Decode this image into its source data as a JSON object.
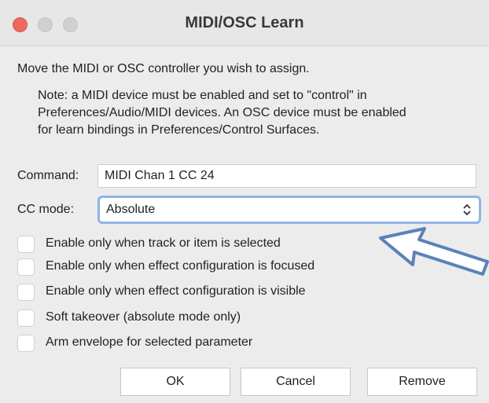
{
  "window": {
    "title": "MIDI/OSC Learn",
    "controls": [
      {
        "name": "close",
        "color": "#ee6a5f"
      },
      {
        "name": "minimize",
        "color": "#d0d0d0"
      },
      {
        "name": "zoom",
        "color": "#d0d0d0"
      }
    ]
  },
  "instructions": "Move the MIDI or OSC controller you wish to assign.",
  "note": {
    "lines": [
      "Note: a MIDI device must be enabled and set to \"control\" in",
      "Preferences/Audio/MIDI devices. An OSC device must be enabled",
      "for learn bindings in Preferences/Control Surfaces."
    ]
  },
  "command": {
    "label": "Command:",
    "value": "MIDI Chan 1 CC 24"
  },
  "cc_mode": {
    "label": "CC mode:",
    "value": "Absolute"
  },
  "options": [
    {
      "label": "Enable only when track or item is selected",
      "checked": false
    },
    {
      "label": "Enable only when effect configuration is focused",
      "checked": false
    },
    {
      "label": "Enable only when effect configuration is visible",
      "checked": false
    },
    {
      "label": "Soft takeover (absolute mode only)",
      "checked": false
    },
    {
      "label": "Arm envelope for selected parameter",
      "checked": false
    }
  ],
  "buttons": {
    "ok": "OK",
    "cancel": "Cancel",
    "remove": "Remove"
  },
  "colors": {
    "accent": "#8fb4e6",
    "arrow": "#5b82b8"
  }
}
